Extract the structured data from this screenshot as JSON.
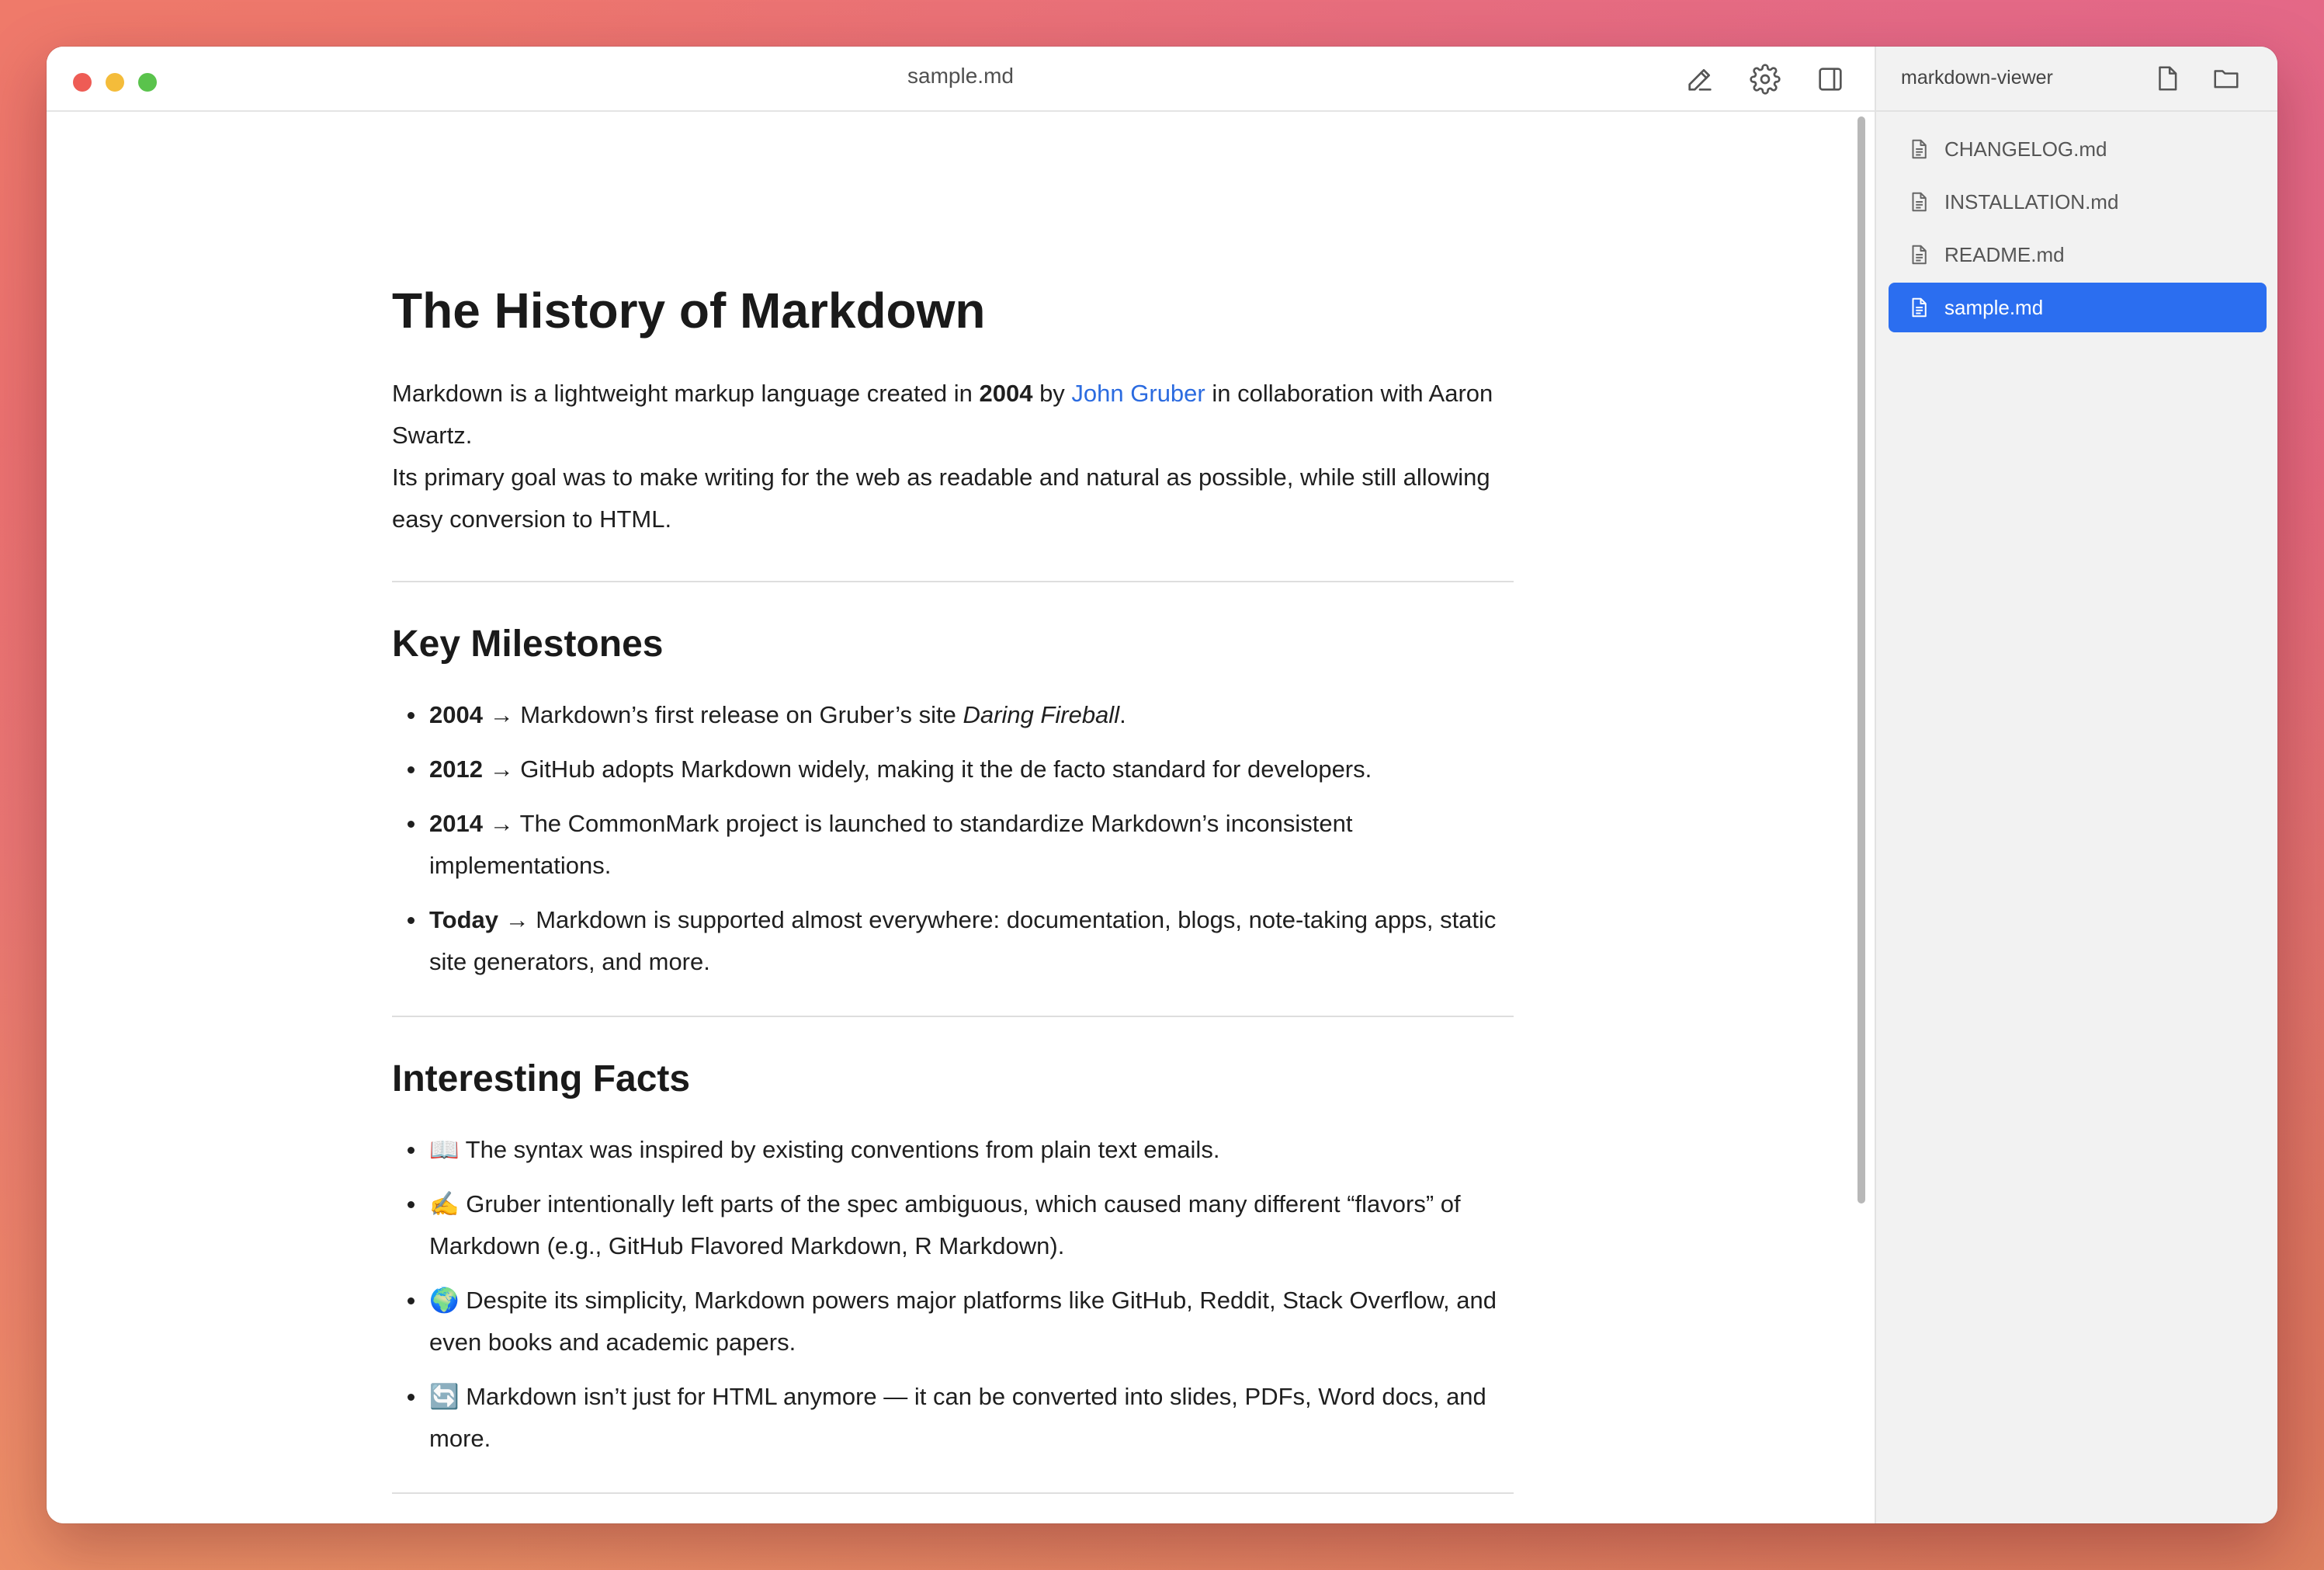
{
  "window": {
    "title": "sample.md",
    "toolbar": {
      "edit_icon": "pencil-icon",
      "settings_icon": "gear-icon",
      "sidebar_icon": "sidebar-toggle-icon"
    }
  },
  "document": {
    "h1": "The History of Markdown",
    "intro": {
      "t1": "Markdown is a lightweight markup language created in ",
      "year": "2004",
      "t2": " by ",
      "link": "John Gruber",
      "t3": " in collaboration with Aaron Swartz.",
      "line2": "Its primary goal was to make writing for the web as readable and natural as possible, while still allowing easy conversion to HTML."
    },
    "milestones": {
      "heading": "Key Milestones",
      "items": [
        {
          "bold": "2004",
          "text": " → Markdown’s first release on Gruber’s site ",
          "italic": "Daring Fireball",
          "tail": "."
        },
        {
          "bold": "2012",
          "text": " → GitHub adopts Markdown widely, making it the de facto standard for developers."
        },
        {
          "bold": "2014",
          "text": " → The CommonMark project is launched to standardize Markdown’s inconsistent implementations."
        },
        {
          "bold": "Today",
          "text": " → Markdown is supported almost everywhere: documentation, blogs, note-taking apps, static site generators, and more."
        }
      ]
    },
    "facts": {
      "heading": "Interesting Facts",
      "items": [
        "📖 The syntax was inspired by existing conventions from plain text emails.",
        "✍️ Gruber intentionally left parts of the spec ambiguous, which caused many different “flavors” of Markdown (e.g., GitHub Flavored Markdown, R Markdown).",
        "🌍 Despite its simplicity, Markdown powers major platforms like GitHub, Reddit, Stack Overflow, and even books and academic papers.",
        "🔄 Markdown isn’t just for HTML anymore — it can be converted into slides, PDFs, Word docs, and more."
      ]
    }
  },
  "sidebar": {
    "title": "markdown-viewer",
    "new_file_icon": "new-file-icon",
    "open_folder_icon": "folder-icon",
    "files": [
      {
        "name": "CHANGELOG.md",
        "active": false
      },
      {
        "name": "INSTALLATION.md",
        "active": false
      },
      {
        "name": "README.md",
        "active": false
      },
      {
        "name": "sample.md",
        "active": true
      }
    ]
  },
  "colors": {
    "accent": "#2b6ef0",
    "link": "#2b6be0"
  }
}
